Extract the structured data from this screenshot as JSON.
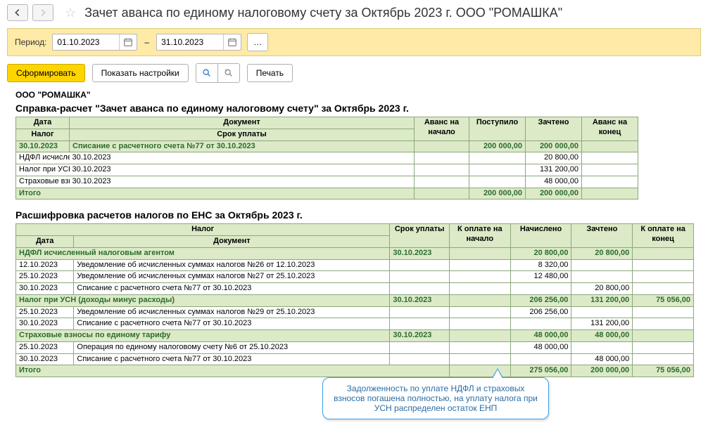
{
  "header": {
    "title": "Зачет аванса по единому налоговому счету за Октябрь 2023 г. ООО \"РОМАШКА\""
  },
  "period": {
    "label": "Период:",
    "from": "01.10.2023",
    "to": "31.10.2023"
  },
  "actions": {
    "generate": "Сформировать",
    "showSettings": "Показать настройки",
    "print": "Печать"
  },
  "report": {
    "org": "ООО \"РОМАШКА\"",
    "title1": "Справка-расчет \"Зачет аванса по единому налоговому счету\"  за Октябрь 2023 г.",
    "title2": "Расшифровка расчетов налогов по ЕНС за Октябрь 2023 г.",
    "table1": {
      "headers": {
        "date": "Дата",
        "doc": "Документ",
        "tax": "Налог",
        "due": "Срок уплаты",
        "start": "Аванс на начало",
        "in": "Поступило",
        "credited": "Зачтено",
        "end": "Аванс на конец"
      },
      "group": {
        "date": "30.10.2023",
        "doc": "Списание с расчетного счета №77 от 30.10.2023",
        "in": "200 000,00",
        "credited": "200 000,00"
      },
      "rows": [
        {
          "tax": "НДФЛ исчисленный налоговым агентом",
          "due": "30.10.2023",
          "credited": "20 800,00"
        },
        {
          "tax": "Налог при УСН (доходы минус расходы)",
          "due": "30.10.2023",
          "credited": "131 200,00"
        },
        {
          "tax": "Страховые взносы по единому тарифу",
          "due": "30.10.2023",
          "credited": "48 000,00"
        }
      ],
      "total": {
        "label": "Итого",
        "in": "200 000,00",
        "credited": "200 000,00"
      }
    },
    "table2": {
      "headers": {
        "tax": "Налог",
        "due": "Срок уплаты",
        "payStart": "К оплате на начало",
        "accr": "Начислено",
        "credited": "Зачтено",
        "payEnd": "К оплате на конец",
        "date": "Дата",
        "doc": "Документ"
      },
      "groups": [
        {
          "name": "НДФЛ исчисленный налоговым агентом",
          "due": "30.10.2023",
          "accr": "20 800,00",
          "credited": "20 800,00",
          "payEnd": "",
          "rows": [
            {
              "date": "12.10.2023",
              "doc": "Уведомление об исчисленных суммах налогов №26 от 12.10.2023",
              "accr": "8 320,00"
            },
            {
              "date": "25.10.2023",
              "doc": "Уведомление об исчисленных суммах налогов №27 от 25.10.2023",
              "accr": "12 480,00"
            },
            {
              "date": "30.10.2023",
              "doc": "Списание с расчетного счета №77 от 30.10.2023",
              "credited": "20 800,00"
            }
          ]
        },
        {
          "name": "Налог при УСН (доходы минус расходы)",
          "due": "30.10.2023",
          "accr": "206 256,00",
          "credited": "131 200,00",
          "payEnd": "75 056,00",
          "rows": [
            {
              "date": "25.10.2023",
              "doc": "Уведомление об исчисленных суммах налогов №29 от 25.10.2023",
              "accr": "206 256,00"
            },
            {
              "date": "30.10.2023",
              "doc": "Списание с расчетного счета №77 от 30.10.2023",
              "credited": "131 200,00"
            }
          ]
        },
        {
          "name": "Страховые взносы по единому тарифу",
          "due": "30.10.2023",
          "accr": "48 000,00",
          "credited": "48 000,00",
          "payEnd": "",
          "rows": [
            {
              "date": "25.10.2023",
              "doc": "Операция по единому налоговому счету №6 от 25.10.2023",
              "accr": "48 000,00"
            },
            {
              "date": "30.10.2023",
              "doc": "Списание с расчетного счета №77 от 30.10.2023",
              "credited": "48 000,00"
            }
          ]
        }
      ],
      "total": {
        "label": "Итого",
        "accr": "275 056,00",
        "credited": "200 000,00",
        "payEnd": "75 056,00"
      }
    },
    "callout": "Задолженность по уплате НДФЛ и страховых взносов погашена полностью, на уплату налога при УСН распределен остаток ЕНП"
  }
}
